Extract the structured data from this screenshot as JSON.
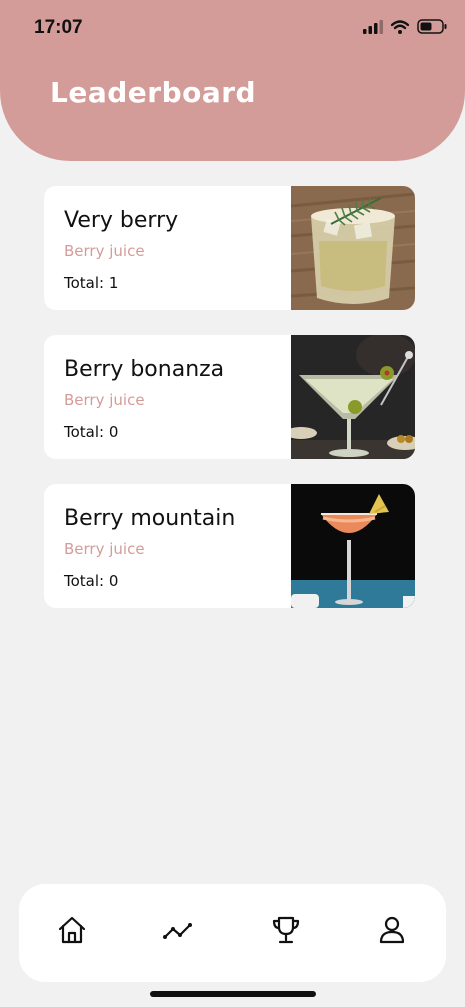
{
  "status_bar": {
    "time": "17:07",
    "icons": [
      "cellular-signal-icon",
      "wifi-icon",
      "battery-icon"
    ]
  },
  "header": {
    "title": "Leaderboard",
    "background_color": "#d49c99"
  },
  "cards": [
    {
      "name": "Very berry",
      "subtitle": "Berry juice",
      "total": "Total: 1",
      "image": "cocktail-rosemary-photo"
    },
    {
      "name": "Berry bonanza",
      "subtitle": "Berry juice",
      "total": "Total: 0",
      "image": "martini-olives-photo"
    },
    {
      "name": "Berry mountain",
      "subtitle": "Berry juice",
      "total": "Total: 0",
      "image": "orange-coupe-cocktail-photo"
    }
  ],
  "tab_bar": {
    "items": [
      {
        "icon": "home-icon"
      },
      {
        "icon": "stats-icon"
      },
      {
        "icon": "trophy-icon"
      },
      {
        "icon": "profile-icon"
      }
    ]
  },
  "colors": {
    "accent": "#d49c99",
    "background": "#f1f1f1",
    "card": "#ffffff"
  }
}
